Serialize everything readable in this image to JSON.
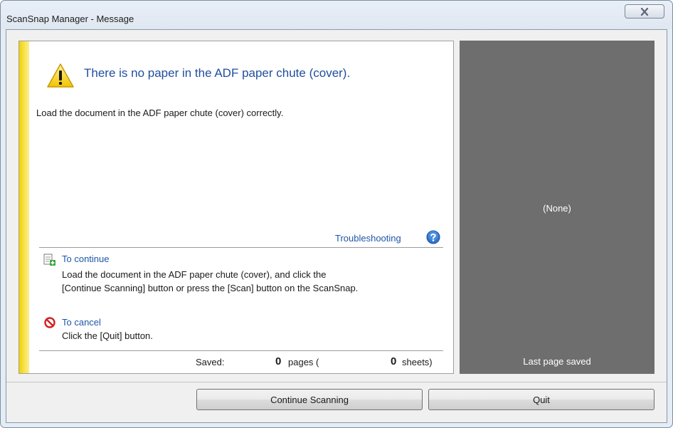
{
  "window": {
    "title": "ScanSnap Manager - Message",
    "close_icon": "close-x-icon"
  },
  "message": {
    "warning_icon": "warning-triangle-icon",
    "headline": "There is no paper in the ADF paper chute (cover).",
    "detail": "Load the document in the ADF paper chute (cover) correctly.",
    "troubleshooting_link": "Troubleshooting",
    "help_icon": "help-question-icon"
  },
  "continue_section": {
    "icon": "continue-scan-icon",
    "title": "To continue",
    "line1": "Load the document in the ADF paper chute (cover), and click the",
    "line2": "[Continue Scanning] button or press the [Scan] button on the ScanSnap."
  },
  "cancel_section": {
    "icon": "cancel-icon",
    "title": "To cancel",
    "text": "Click the [Quit] button."
  },
  "saved": {
    "label": "Saved:",
    "pages_count": "0",
    "pages_text": "pages (",
    "sheets_count": "0",
    "sheets_text": "sheets)"
  },
  "preview": {
    "placeholder": "(None)",
    "caption": "Last page saved"
  },
  "buttons": {
    "continue_label": "Continue Scanning",
    "quit_label": "Quit"
  },
  "colors": {
    "accent_link": "#1f56a8",
    "headline": "#1f4e9e",
    "warning_bar": "#f1d200",
    "preview_bg": "#6e6e6e"
  }
}
